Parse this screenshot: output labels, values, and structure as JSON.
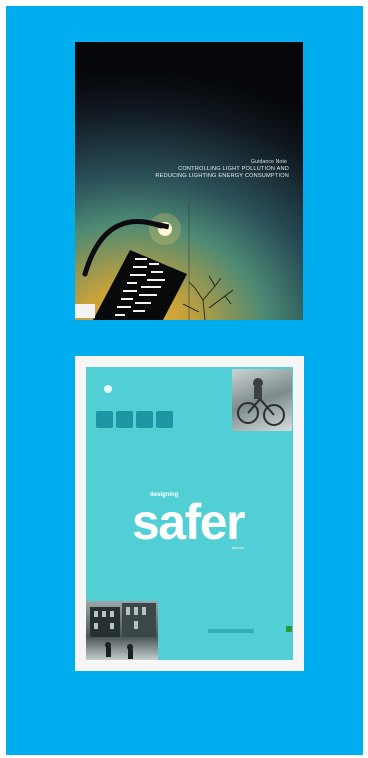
{
  "covers": [
    {
      "kicker": "Guidance Note",
      "title_line1": "CONTROLLING LIGHT POLLUTION AND",
      "title_line2": "REDUCING LIGHTING ENERGY CONSUMPTION",
      "image_name": "streetlamp-at-dusk"
    },
    {
      "word_pre": "designing",
      "word_main": "safer",
      "word_post": "places",
      "image_name": "cyclists-photo"
    }
  ],
  "colors": {
    "page_background": "#00aeef",
    "cover2_teal": "#51cfd4"
  }
}
